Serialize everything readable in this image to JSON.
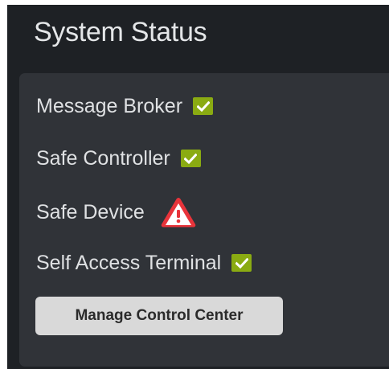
{
  "panel": {
    "title": "System Status"
  },
  "statuses": [
    {
      "label": "Message Broker",
      "state": "ok",
      "icon": "checkmark-icon"
    },
    {
      "label": "Safe Controller",
      "state": "ok",
      "icon": "checkmark-icon"
    },
    {
      "label": "Safe Device",
      "state": "warning",
      "icon": "warning-triangle-icon"
    },
    {
      "label": "Self Access Terminal",
      "state": "ok",
      "icon": "checkmark-icon"
    }
  ],
  "actions": {
    "manage_label": "Manage Control Center"
  },
  "colors": {
    "background": "#1e2125",
    "panel": "#303338",
    "ok": "#8aab12",
    "warning": "#e8343b",
    "button": "#d9d9d9"
  }
}
